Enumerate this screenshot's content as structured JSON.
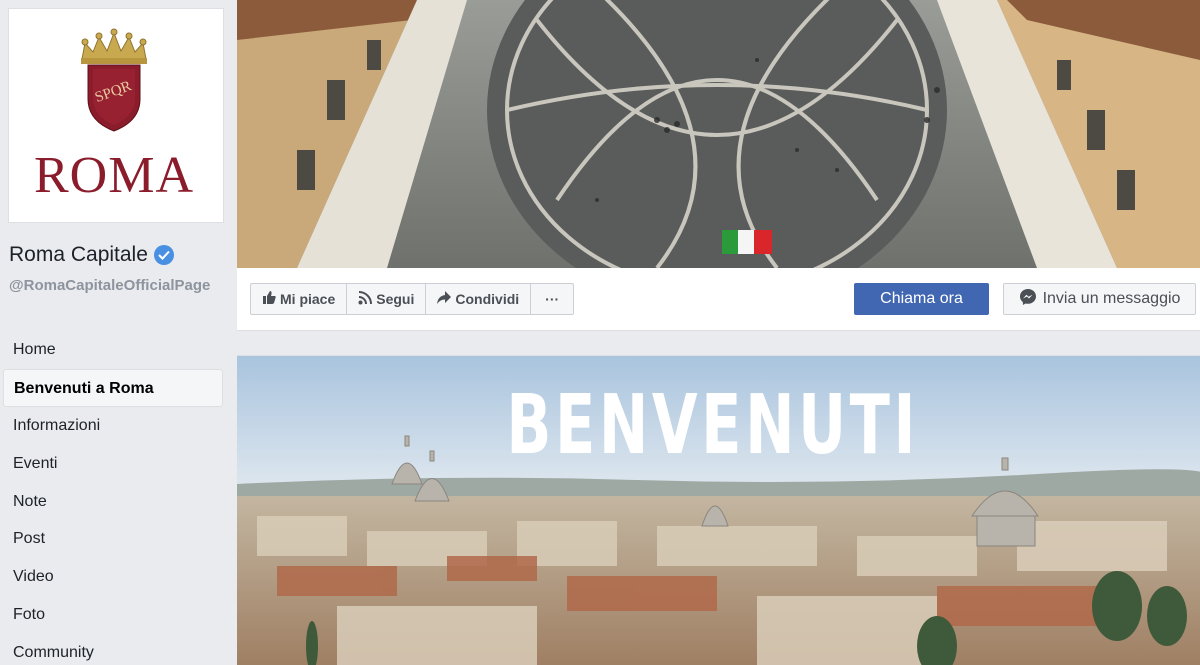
{
  "page": {
    "logo_text": "ROMA",
    "logo_shield_text": "SPQR",
    "name": "Roma Capitale",
    "handle": "@RomaCapitaleOfficialPage"
  },
  "nav": {
    "items": [
      {
        "label": "Home"
      },
      {
        "label": "Benvenuti a Roma",
        "active": true
      },
      {
        "label": "Informazioni"
      },
      {
        "label": "Eventi"
      },
      {
        "label": "Note"
      },
      {
        "label": "Post"
      },
      {
        "label": "Video"
      },
      {
        "label": "Foto"
      },
      {
        "label": "Community"
      }
    ]
  },
  "actions": {
    "like": "Mi piace",
    "follow": "Segui",
    "share": "Condividi",
    "more": "···",
    "call": "Chiama ora",
    "message": "Invia un messaggio"
  },
  "welcome": {
    "title": "BENVENUTI"
  },
  "colors": {
    "brand_crimson": "#8a1c2b",
    "facebook_blue": "#4267b2",
    "verified_blue": "#4a90e2"
  },
  "icons": [
    "thumbs-up-icon",
    "rss-icon",
    "share-arrow-icon",
    "messenger-icon",
    "verified-badge-icon"
  ]
}
